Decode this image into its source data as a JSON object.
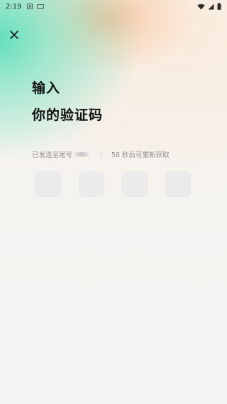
{
  "status_bar": {
    "time": "2:19",
    "left_icons": [
      "android-system-icon",
      "keyboard-icon"
    ],
    "right_icons": [
      "wifi-icon",
      "signal-icon",
      "battery-icon"
    ]
  },
  "close_button": {
    "icon": "close-icon"
  },
  "heading": {
    "line1": "输入",
    "line2": "你的验证码"
  },
  "info": {
    "sent_text": "已发送至尾号",
    "resend_text": "58 秒后可重新获取"
  },
  "code_inputs": [
    {
      "value": ""
    },
    {
      "value": ""
    },
    {
      "value": ""
    },
    {
      "value": ""
    }
  ],
  "colors": {
    "accent_teal": "#56deb8",
    "accent_peach": "#f6be96",
    "title_text": "#121212",
    "muted_text": "#8e8e8e",
    "code_box_bg": "#ebebeb"
  }
}
